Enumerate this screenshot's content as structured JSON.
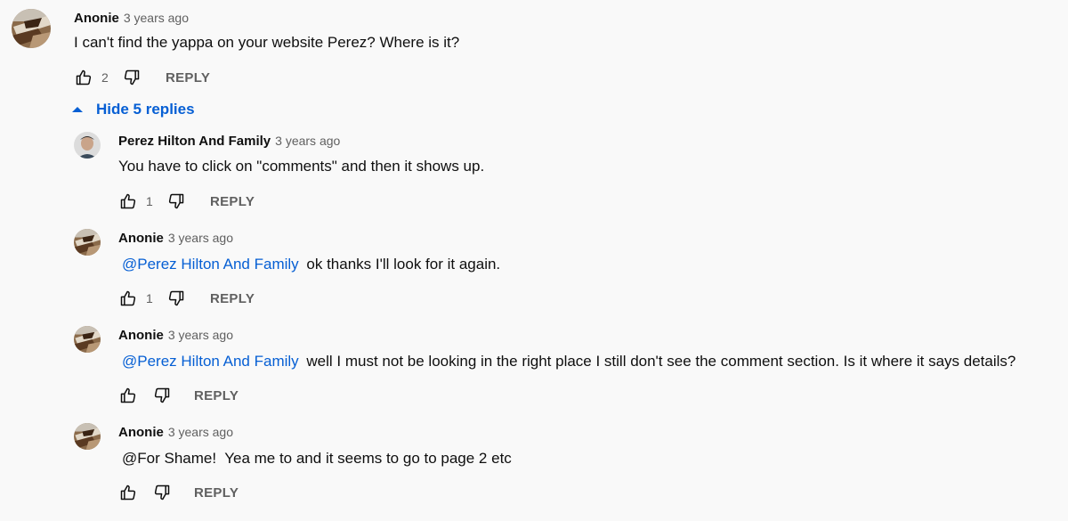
{
  "top_comment": {
    "author": "Anonie",
    "time": "3 years ago",
    "text": "I can't find the yappa on your website Perez? Where is it?",
    "likes": "2",
    "reply_label": "REPLY"
  },
  "replies_toggle": {
    "label": "Hide 5 replies"
  },
  "replies": [
    {
      "author": "Perez Hilton And Family",
      "time": "3 years ago",
      "mention": "",
      "text": "You have to click on \"comments\" and then it shows up.",
      "likes": "1",
      "reply_label": "REPLY"
    },
    {
      "author": "Anonie",
      "time": "3 years ago",
      "mention": "@Perez Hilton And Family",
      "text": "ok thanks I'll look for it again.",
      "likes": "1",
      "reply_label": "REPLY"
    },
    {
      "author": "Anonie",
      "time": "3 years ago",
      "mention": "@Perez Hilton And Family",
      "text": "well I must not be looking in the right place I still don't see the comment section. Is it where it says details?",
      "likes": "",
      "reply_label": "REPLY"
    },
    {
      "author": "Anonie",
      "time": "3 years ago",
      "mention": "",
      "text": "@For Shame!  Yea me to and it seems to go to page 2 etc",
      "likes": "",
      "reply_label": "REPLY"
    }
  ],
  "colors": {
    "background": "#f9f9f9",
    "link": "#065fd4",
    "secondary_text": "#606060"
  },
  "icons": [
    "thumbs-up-icon",
    "thumbs-down-icon",
    "caret-up-icon",
    "avatar-anonie",
    "avatar-perez"
  ]
}
